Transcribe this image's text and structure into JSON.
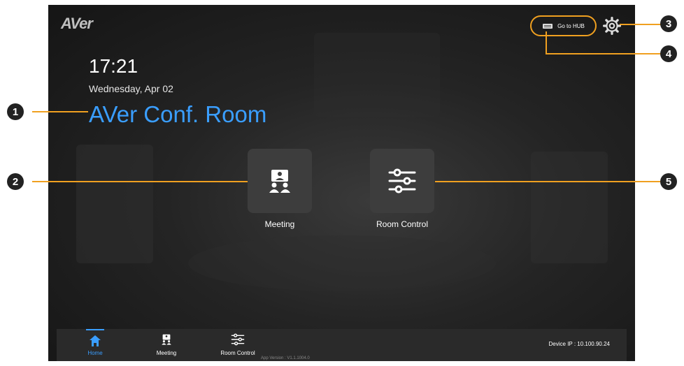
{
  "brand": {
    "logo_text": "AVer"
  },
  "header": {
    "time": "17:21",
    "date": "Wednesday, Apr 02",
    "room_name": "AVer Conf. Room"
  },
  "top_actions": {
    "hub_label": "Go to HUB",
    "hub_icon": "hub-device-icon",
    "settings_icon": "gear-icon"
  },
  "tiles": [
    {
      "label": "Meeting",
      "icon": "meeting-icon"
    },
    {
      "label": "Room Control",
      "icon": "sliders-icon"
    }
  ],
  "nav": {
    "items": [
      {
        "label": "Home",
        "icon": "home-icon",
        "active": true
      },
      {
        "label": "Meeting",
        "icon": "meeting-icon",
        "active": false
      },
      {
        "label": "Room Control",
        "icon": "sliders-icon",
        "active": false
      }
    ],
    "device_ip": "Device IP : 10.100.90.24"
  },
  "footer": {
    "app_version": "App Version : V1.1.1004.0"
  },
  "callouts": [
    "1",
    "2",
    "3",
    "4",
    "5"
  ],
  "colors": {
    "accent": "#3a9eff",
    "callout_line": "#f0a020",
    "background": "#1e1e1e"
  }
}
